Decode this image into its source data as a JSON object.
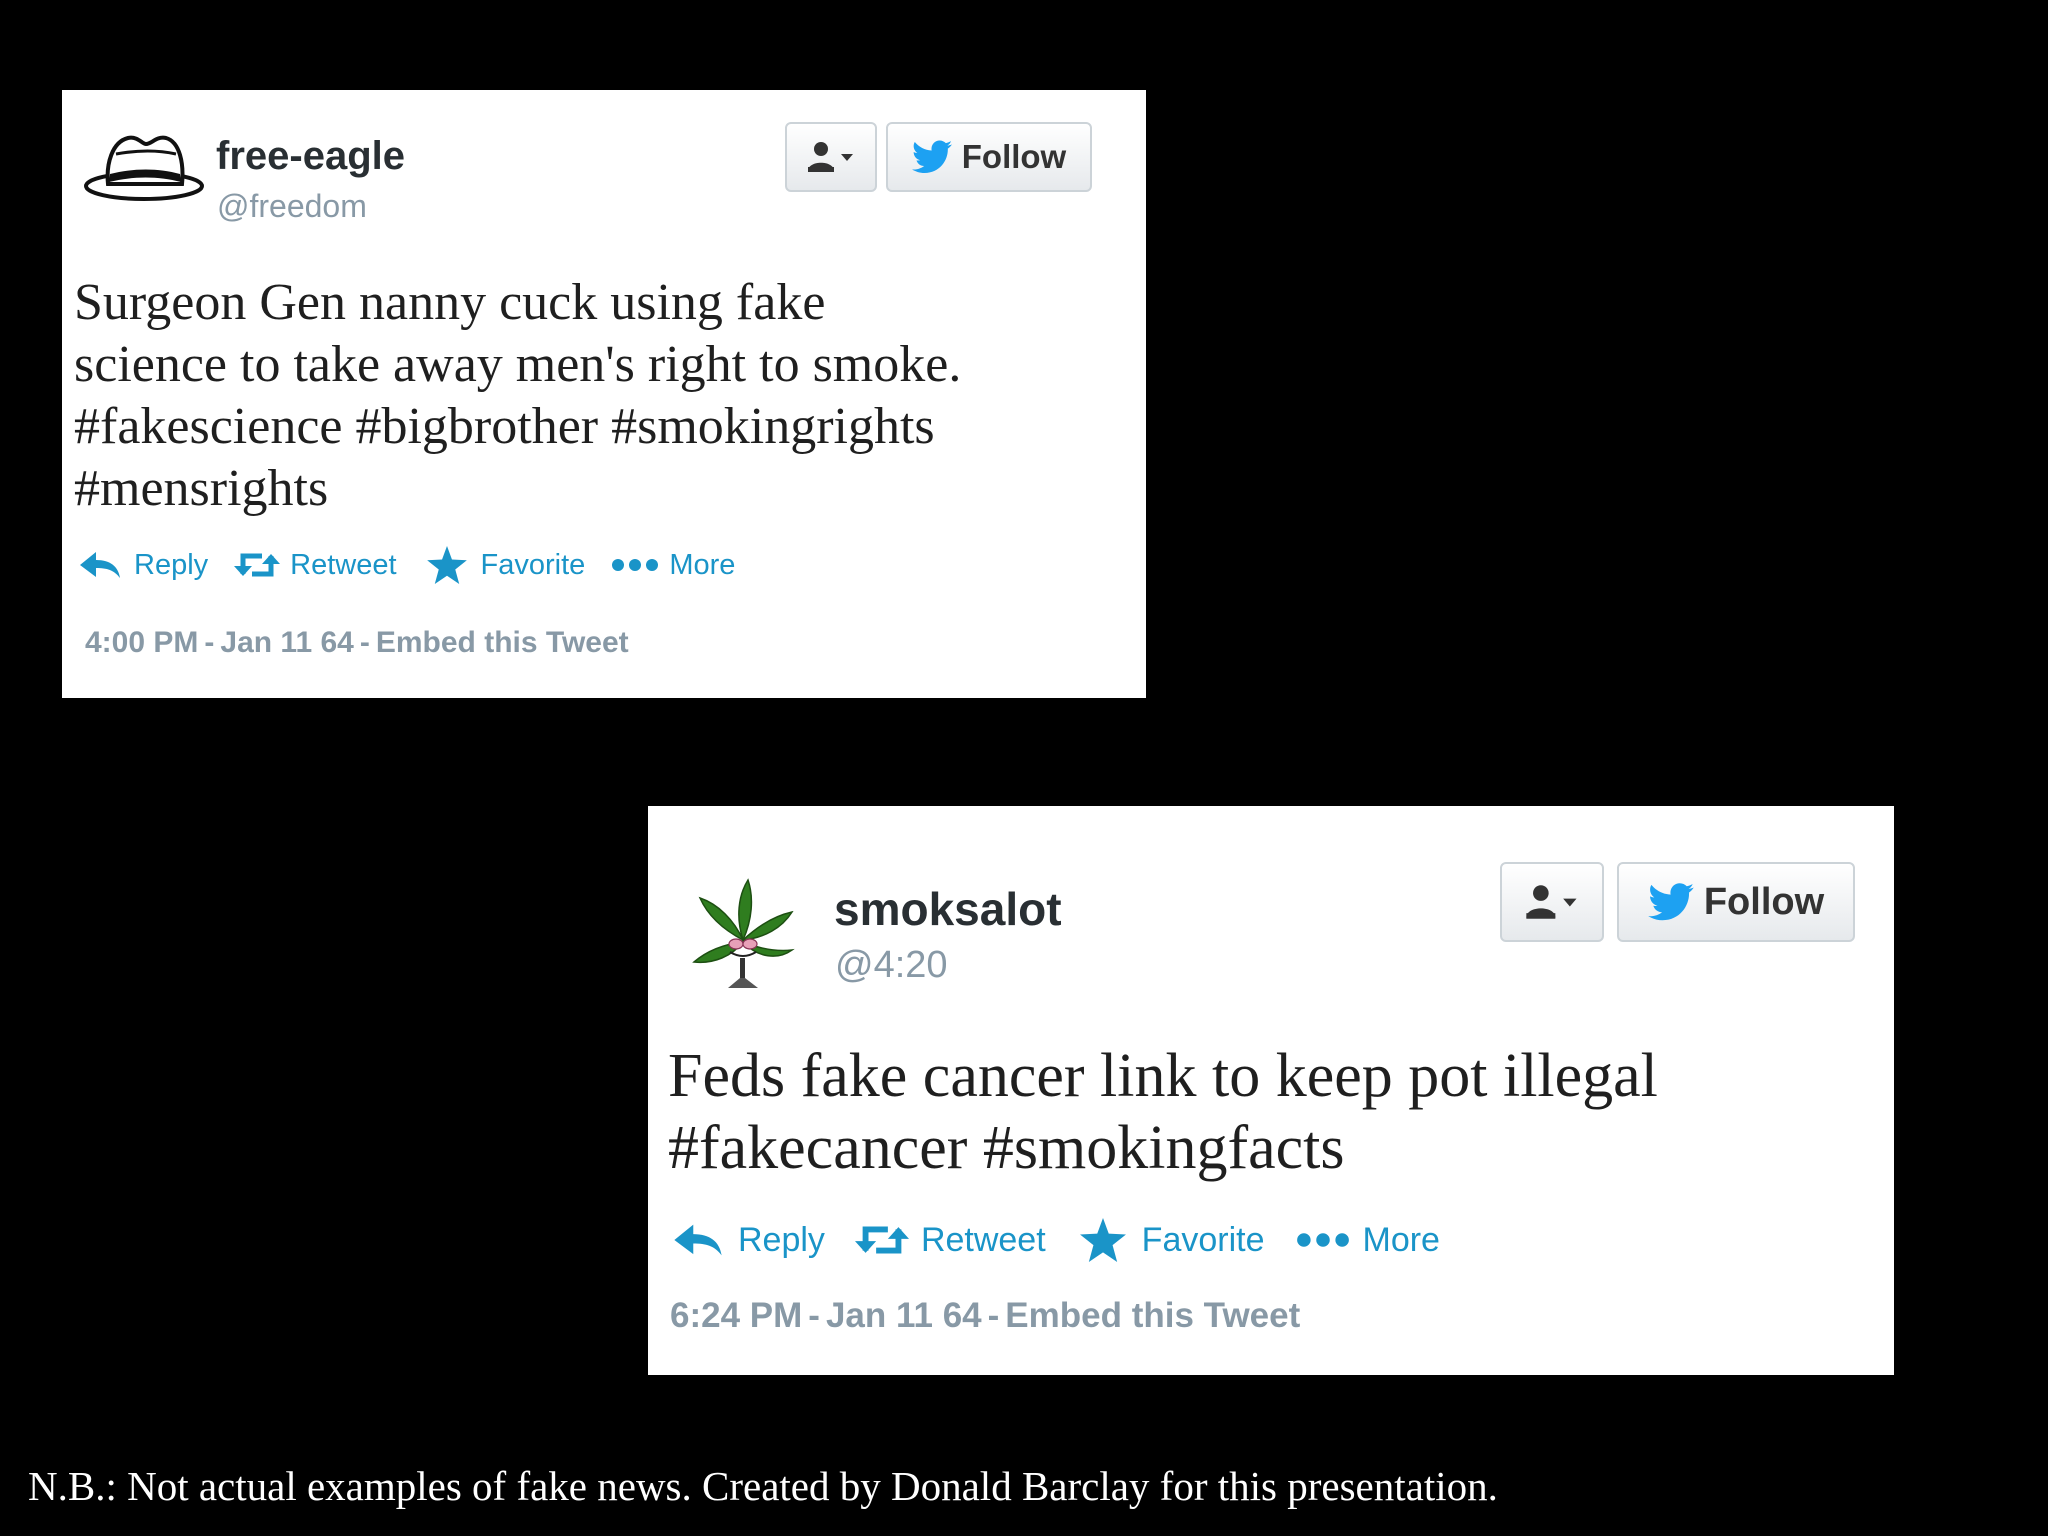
{
  "colors": {
    "background": "#000000",
    "card": "#ffffff",
    "action_blue": "#1a94c8",
    "twitter_blue": "#1da1f2",
    "muted": "#8899a6"
  },
  "tweets": [
    {
      "avatar_icon": "fedora-hat-icon",
      "display_name": "free-eagle",
      "handle": "@freedom",
      "user_menu_icon": "person-dropdown-icon",
      "follow_label": "Follow",
      "text": "Surgeon Gen nanny cuck using fake\nscience to take away men's right to smoke.\n#fakescience #bigbrother #smokingrights\n#mensrights",
      "actions": {
        "reply": "Reply",
        "retweet": "Retweet",
        "favorite": "Favorite",
        "more": "More"
      },
      "time": "4:00 PM",
      "date": "Jan 11 64",
      "embed": "Embed this Tweet"
    },
    {
      "avatar_icon": "cannabis-leaf-icon",
      "display_name": "smoksalot",
      "handle": "@4:20",
      "user_menu_icon": "person-dropdown-icon",
      "follow_label": "Follow",
      "text": "Feds fake cancer link to keep pot illegal\n#fakecancer #smokingfacts",
      "actions": {
        "reply": "Reply",
        "retweet": "Retweet",
        "favorite": "Favorite",
        "more": "More"
      },
      "time": "6:24 PM",
      "date": "Jan 11 64",
      "embed": "Embed this Tweet"
    }
  ],
  "caption": "N.B.: Not actual examples of  fake news. Created by Donald Barclay for this presentation."
}
